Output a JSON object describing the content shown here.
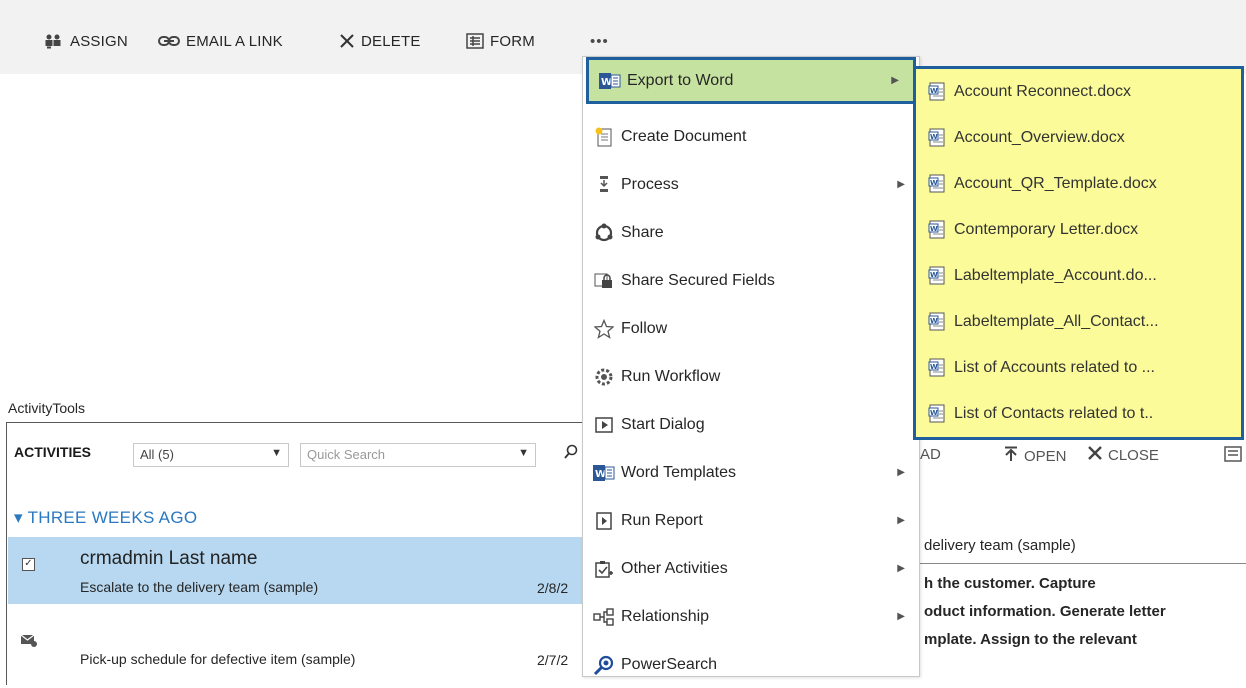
{
  "toolbar": {
    "assign": "ASSIGN",
    "email_link": "EMAIL A LINK",
    "delete": "DELETE",
    "form": "FORM",
    "more": "•••"
  },
  "activity_tools": {
    "title": "ActivityTools",
    "header": "ACTIVITIES",
    "filter_value": "All (5)",
    "search_placeholder": "Quick Search",
    "group_label": "THREE WEEKS AGO",
    "rows": [
      {
        "name": "crmadmin Last name",
        "subject": "Escalate to the delivery team (sample)",
        "date": "2/8/2"
      },
      {
        "name": "",
        "subject": "Pick-up schedule for defective item (sample)",
        "date": "2/7/2"
      }
    ]
  },
  "behind_menu": {
    "ad_fragment": "AD",
    "open": "OPEN",
    "close": "CLOSE",
    "heading_fragment": "delivery team (sample)",
    "line1": "h the customer. Capture",
    "line2": "oduct information. Generate letter",
    "line3": "mplate. Assign to the relevant"
  },
  "menu": {
    "items": [
      {
        "label": "Export to Word",
        "icon": "word-icon",
        "submenu": true
      },
      {
        "label": "Create Document",
        "icon": "new-document-icon",
        "submenu": false
      },
      {
        "label": "Process",
        "icon": "process-icon",
        "submenu": true
      },
      {
        "label": "Share",
        "icon": "share-icon",
        "submenu": false
      },
      {
        "label": "Share Secured Fields",
        "icon": "lock-share-icon",
        "submenu": false
      },
      {
        "label": "Follow",
        "icon": "star-icon",
        "submenu": false
      },
      {
        "label": "Run Workflow",
        "icon": "workflow-icon",
        "submenu": false
      },
      {
        "label": "Start Dialog",
        "icon": "play-box-icon",
        "submenu": false
      },
      {
        "label": "Word Templates",
        "icon": "word-icon",
        "submenu": true
      },
      {
        "label": "Run Report",
        "icon": "report-icon",
        "submenu": true
      },
      {
        "label": "Other Activities",
        "icon": "activities-icon",
        "submenu": true
      },
      {
        "label": "Relationship",
        "icon": "relationship-icon",
        "submenu": true
      },
      {
        "label": "PowerSearch",
        "icon": "powersearch-icon",
        "submenu": false
      }
    ]
  },
  "submenu": {
    "items": [
      "Account Reconnect.docx",
      "Account_Overview.docx",
      "Account_QR_Template.docx",
      "Contemporary Letter.docx",
      "Labeltemplate_Account.do...",
      "Labeltemplate_All_Contact...",
      "List of Accounts related to ...",
      "List of Contacts related to t.."
    ]
  },
  "colors": {
    "highlight_green": "#c6e2a0",
    "highlight_border": "#1f5f9e",
    "submenu_yellow": "#fbfb9a",
    "selected_row": "#b7d8f0",
    "group_blue": "#2a78c2"
  }
}
